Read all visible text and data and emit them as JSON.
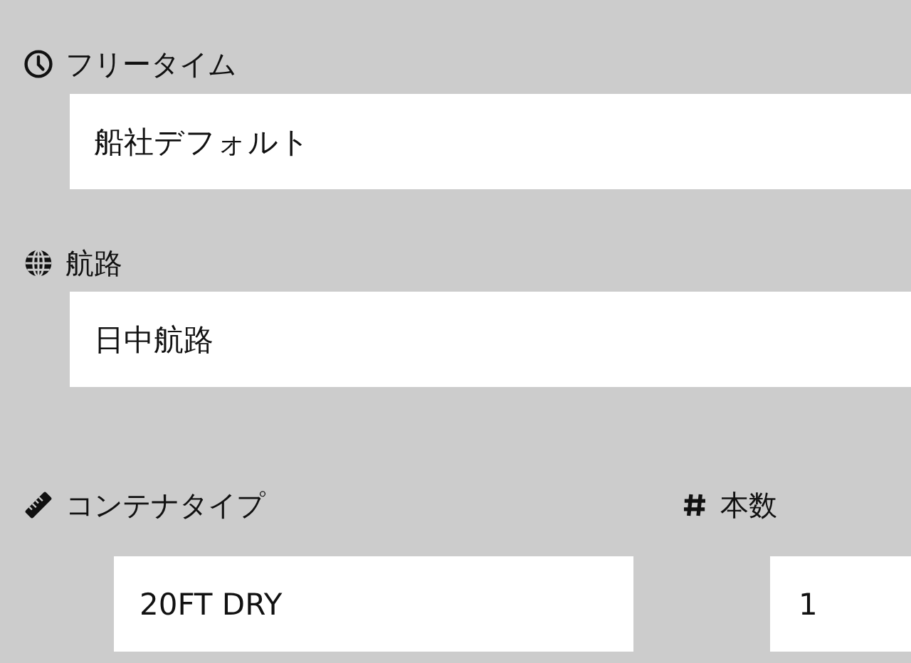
{
  "free_time": {
    "label": "フリータイム",
    "value": "船社デフォルト"
  },
  "route": {
    "label": "航路",
    "value": "日中航路"
  },
  "container_type": {
    "label": "コンテナタイプ",
    "value": "20FT DRY"
  },
  "quantity": {
    "label": "本数",
    "value": "1"
  }
}
